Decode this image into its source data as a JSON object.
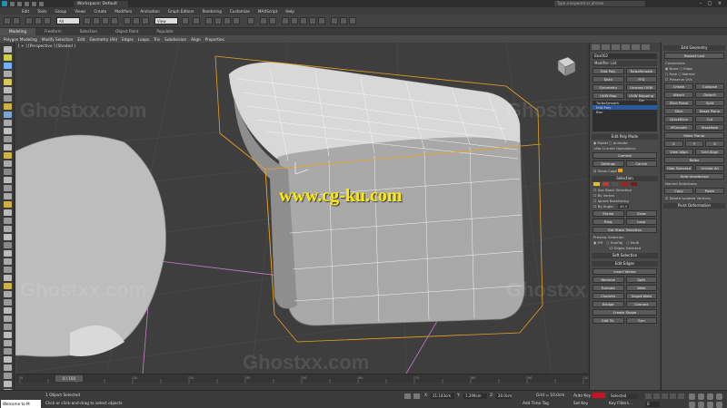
{
  "window": {
    "workspace_label": "Workspace: Default",
    "search_placeholder": "Type a keyword or phrase"
  },
  "menu": {
    "items": [
      "Edit",
      "Tools",
      "Group",
      "Views",
      "Create",
      "Modifiers",
      "Animation",
      "Graph Editors",
      "Rendering",
      "Customize",
      "MAXScript",
      "Help"
    ]
  },
  "toolbar": {
    "selection_filter": "All",
    "view_dropdown": "View"
  },
  "ribbon": {
    "tabs": [
      "Modeling",
      "Freeform",
      "Selection",
      "Object Paint",
      "Populate"
    ],
    "active_tab_index": 0,
    "sub_items": [
      "Polygon Modeling",
      "Modify Selection",
      "Edit",
      "Geometry (All)",
      "Edges",
      "Loops",
      "Tris",
      "Subdivision",
      "Align",
      "Properties"
    ]
  },
  "viewport": {
    "label": "[ + ] [Perspective ] [Shaded ]",
    "watermark": "Ghostxx.com",
    "overlay_url": "www.cg-ku.com"
  },
  "command_panel": {
    "object_name": "Box002",
    "modifier_list": "Modifier List",
    "quick_buttons": [
      [
        "Edit Poly",
        "TurboSmooth"
      ],
      [
        "Shell",
        "FFD"
      ],
      [
        "Symmetry",
        "Unwrap UVW"
      ],
      [
        "UVW Map",
        "UVW Mapping Cle"
      ]
    ],
    "stack": [
      "TurboSmooth",
      "Edit Poly",
      "Box"
    ],
    "selected_stack_index": 1,
    "edit_poly_mode": {
      "header": "Edit Poly Mode",
      "model": "Model",
      "animate": "Animate",
      "no_op": "<No Current Operation>",
      "commit": "Commit",
      "settings": "Settings",
      "cancel": "Cancel",
      "show_cage": "Show Cage"
    },
    "selection": {
      "header": "Selection",
      "options": [
        "Use Stack Selection",
        "By Vertex",
        "Ignore Backfacing",
        "By Angle:"
      ],
      "angle_value": "45.0",
      "buttons": [
        [
          "Shrink",
          "Grow"
        ],
        [
          "Ring",
          "Loop"
        ]
      ],
      "get_stack": "Get Stack Selection",
      "preview_label": "Preview Selection",
      "preview_options": [
        "Off",
        "SubObj",
        "Multi"
      ],
      "selected_count": "12 Edges Selected"
    },
    "soft_selection": "Soft Selection",
    "edit_edges": {
      "header": "Edit Edges",
      "insert_vertex": "Insert Vertex",
      "rows": [
        [
          "Remove",
          "Split"
        ],
        [
          "Extrude",
          "Weld"
        ],
        [
          "Chamfer",
          "Target Weld"
        ],
        [
          "Bridge",
          "Connect"
        ]
      ],
      "create_shape": "Create Shape",
      "edit_tri": [
        "Edit Tri.",
        "Turn"
      ]
    }
  },
  "edit_geometry": {
    "header": "Edit Geometry",
    "repeat_last": "Repeat Last",
    "constraints": "Constraints",
    "constraint_options": [
      "None",
      "Edge",
      "Face",
      "Normal"
    ],
    "preserve_uvs": "Preserve UVs",
    "rows": [
      [
        "Create",
        "Collapse"
      ],
      [
        "Attach",
        "Detach"
      ],
      [
        "Slice Plane",
        "Split"
      ],
      [
        "Slice",
        "Reset Plane"
      ],
      [
        "QuickSlice",
        "Cut"
      ],
      [
        "MSmooth",
        "Tessellate"
      ]
    ],
    "make_planar": "Make Planar",
    "xyz": [
      "X",
      "Y",
      "Z"
    ],
    "align": [
      "View Align",
      "Grid Align"
    ],
    "relax": "Relax",
    "hide": [
      "Hide Selected",
      "Unhide All"
    ],
    "hide_unselected": "Hide Unselected",
    "named_selections": "Named Selections:",
    "copy_paste": [
      "Copy",
      "Paste"
    ],
    "delete_isolated": "Delete Isolated Vertices",
    "paint_deformation": "Paint Deformation"
  },
  "timeline": {
    "frame_display": "0 / 100",
    "ticks": [
      "0",
      "10",
      "20",
      "30",
      "40",
      "50",
      "60",
      "70",
      "80",
      "90",
      "100"
    ]
  },
  "status": {
    "maxscript_text": "Welcome to M",
    "selected_objects": "1 Object Selected",
    "prompt": "Click or click-and-drag to select objects",
    "x": "21.143cm",
    "y": "1.299cm",
    "z": "20.0cm",
    "grid": "Grid = 10.0cm",
    "add_time_tag": "Add Time Tag",
    "auto_key": "Auto Key",
    "set_key": "Set Key",
    "selected_dropdown": "Selected",
    "key_filters": "Key Filters...",
    "frame": "0"
  },
  "colors": {
    "selection_cage": "#e8a020",
    "edge_selected": "#ff3030",
    "auto_key": "#c8141e",
    "stack_highlight": "#2c5aa0"
  }
}
